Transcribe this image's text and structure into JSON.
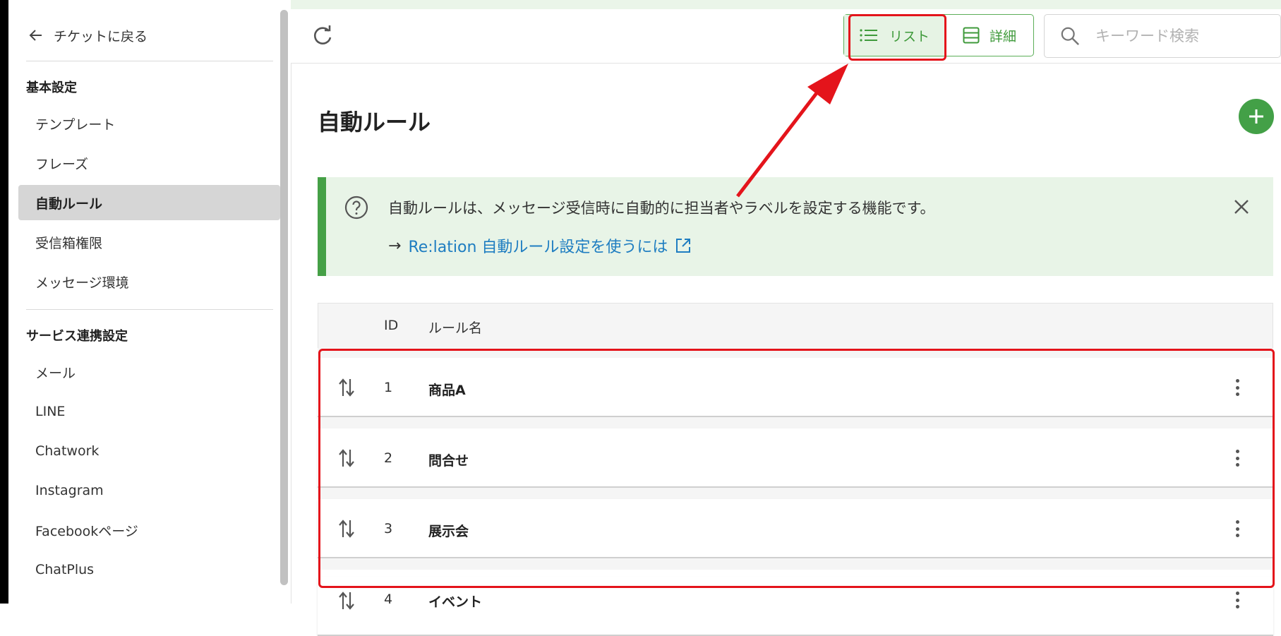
{
  "sidebar": {
    "back_label": "チケットに戻る",
    "sections": [
      {
        "title": "基本設定",
        "items": [
          "テンプレート",
          "フレーズ",
          "自動ルール",
          "受信箱権限",
          "メッセージ環境"
        ]
      },
      {
        "title": "サービス連携設定",
        "items": [
          "メール",
          "LINE",
          "Chatwork",
          "Instagram",
          "Facebookページ",
          "ChatPlus"
        ]
      }
    ],
    "active_item": "自動ルール"
  },
  "toolbar": {
    "list_label": "リスト",
    "detail_label": "詳細",
    "search_placeholder": "キーワード検索"
  },
  "main": {
    "title": "自動ルール",
    "info": {
      "text": "自動ルールは、メッセージ受信時に自動的に担当者やラベルを設定する機能です。",
      "arrow": "→",
      "link_text": "Re:lation 自動ルール設定を使うには"
    },
    "table": {
      "headers": {
        "id": "ID",
        "name": "ルール名"
      },
      "rows": [
        {
          "id": "1",
          "name": "商品A"
        },
        {
          "id": "2",
          "name": "問合せ"
        },
        {
          "id": "3",
          "name": "展示会"
        },
        {
          "id": "4",
          "name": "イベント"
        }
      ]
    }
  },
  "colors": {
    "accent_green": "#43a047",
    "info_bg": "#e8f4e7",
    "link_blue": "#1e7dc1",
    "annotation_red": "#e4141b"
  }
}
